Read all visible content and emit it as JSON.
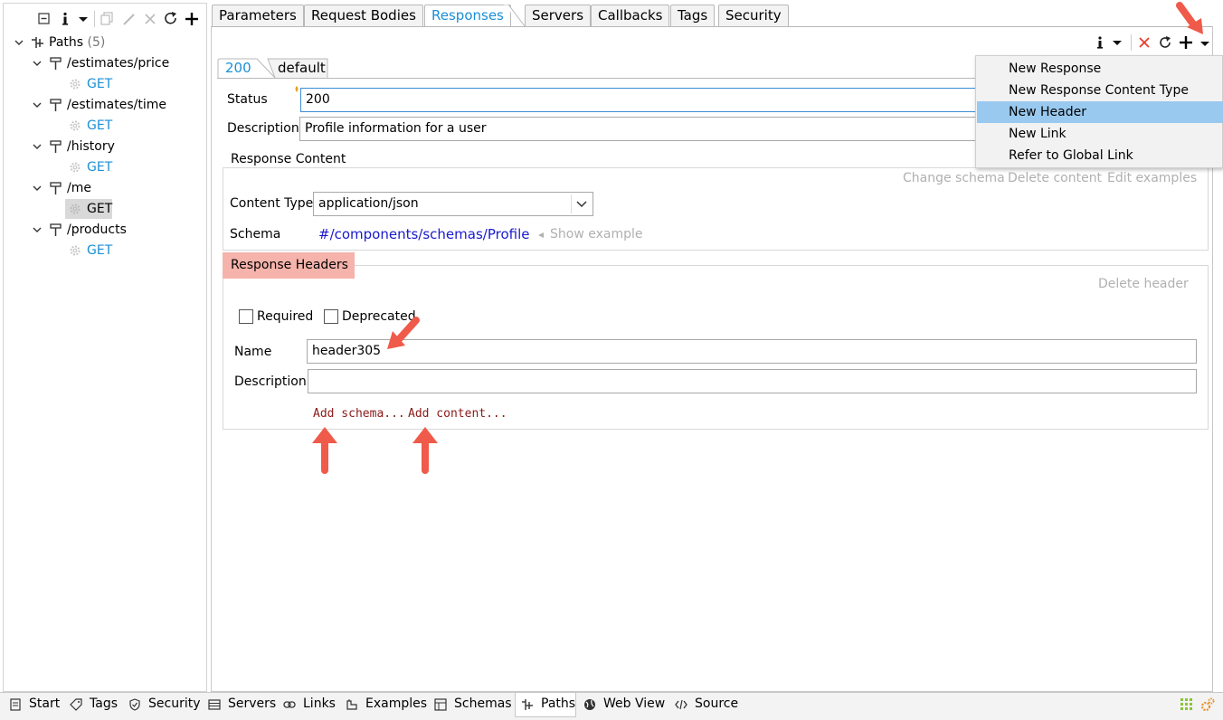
{
  "left_panel": {
    "toolbar_icons": [
      "collapse-all-icon",
      "info-icon",
      "dropdown-icon",
      "copy-icon",
      "edit-icon",
      "delete-icon",
      "refresh-icon",
      "add-icon"
    ],
    "root": {
      "label": "Paths",
      "count": "(5)"
    },
    "paths": [
      {
        "label": "/estimates/price",
        "method": "GET"
      },
      {
        "label": "/estimates/time",
        "method": "GET"
      },
      {
        "label": "/history",
        "method": "GET"
      },
      {
        "label": "/me",
        "method": "GET"
      },
      {
        "label": "/products",
        "method": "GET"
      }
    ]
  },
  "top_tabs": [
    "Parameters",
    "Request Bodies",
    "Responses",
    "Servers",
    "Callbacks",
    "Tags",
    "Security"
  ],
  "active_top_tab": "Responses",
  "response_tabs": [
    "200",
    "default"
  ],
  "form": {
    "status_label": "Status",
    "status_value": "200",
    "description_label": "Description",
    "description_value": "Profile information for a user"
  },
  "response_content": {
    "title": "Response Content",
    "actions": [
      "Change schema",
      "Delete content",
      "Edit examples"
    ],
    "content_type_label": "Content Type",
    "content_type_value": "application/json",
    "schema_label": "Schema",
    "schema_value": "#/components/schemas/Profile",
    "show_example": "Show example"
  },
  "response_headers": {
    "title": "Response Headers",
    "delete_header": "Delete header",
    "required_label": "Required",
    "deprecated_label": "Deprecated",
    "name_label": "Name",
    "name_value": "header305",
    "description_label": "Description",
    "description_value": "",
    "add_schema": "Add schema...",
    "add_content": "Add content..."
  },
  "dropdown_menu": {
    "items": [
      "New Response",
      "New Response Content Type",
      "New Header",
      "New Link",
      "Refer to Global Link"
    ],
    "highlighted": "New Header"
  },
  "bottom_tabs": [
    "Start",
    "Tags",
    "Security",
    "Servers",
    "Links",
    "Examples",
    "Schemas",
    "Paths",
    "Web View",
    "Source"
  ],
  "active_bottom_tab": "Paths",
  "colors": {
    "accent_blue": "#1a8fd6",
    "schema_link": "#1a1acc",
    "header_highlight": "#f5b3ab",
    "menu_highlight": "#99c9ef",
    "annotation_arrow": "#f05a4a",
    "dark_red_link": "#8b1a1a"
  }
}
